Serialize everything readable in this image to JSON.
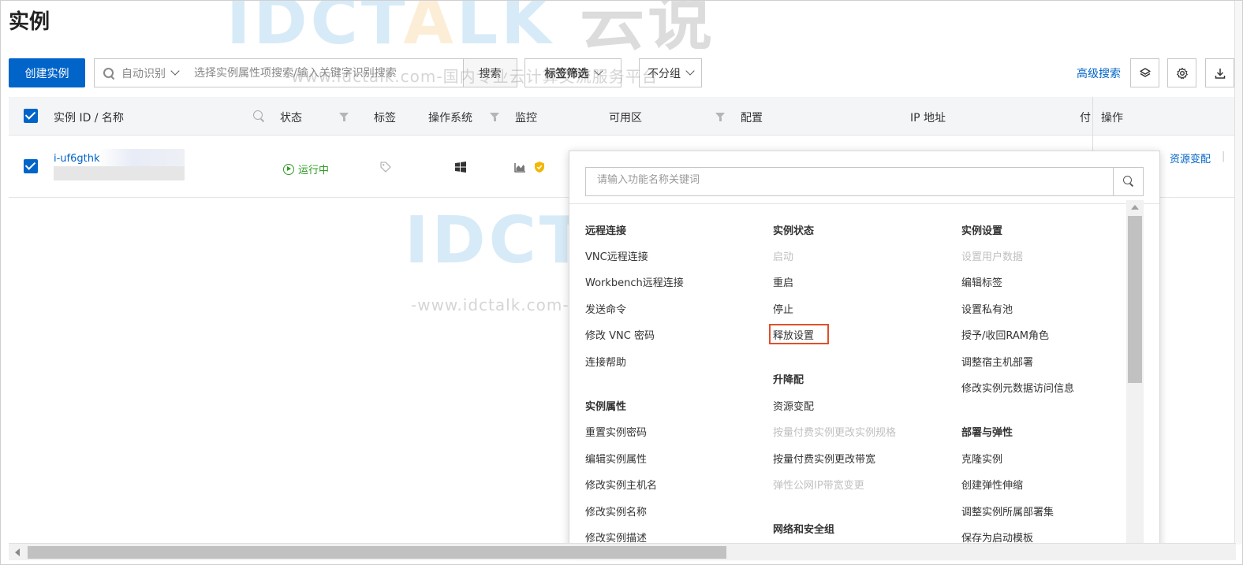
{
  "page": {
    "title": "实例"
  },
  "toolbar": {
    "create_label": "创建实例",
    "auto_identify": "自动识别",
    "search_placeholder": "选择实例属性项搜索/输入关键字识别搜索",
    "search_label": "搜索",
    "tag_filter": "标签筛选",
    "group": "不分组",
    "advanced_search": "高级搜索"
  },
  "table": {
    "headers": {
      "id_name": "实例 ID / 名称",
      "status": "状态",
      "tags": "标签",
      "os": "操作系统",
      "monitor": "监控",
      "zone": "可用区",
      "config": "配置",
      "ip": "IP 地址",
      "pay": "付",
      "ops": "操作"
    },
    "row": {
      "instance_id": "i-uf6gthk",
      "status": "运行中",
      "op_resource": "资源变配"
    }
  },
  "popup": {
    "search_placeholder": "请输入功能名称关键词",
    "col1": {
      "remote_title": "远程连接",
      "remote_items": [
        "VNC远程连接",
        "Workbench远程连接",
        "发送命令",
        "修改 VNC 密码",
        "连接帮助"
      ],
      "props_title": "实例属性",
      "props_items": [
        "重置实例密码",
        "编辑实例属性",
        "修改实例主机名",
        "修改实例名称",
        "修改实例描述"
      ]
    },
    "col2": {
      "state_title": "实例状态",
      "state_items": [
        "启动",
        "重启",
        "停止",
        "释放设置"
      ],
      "upgrade_title": "升降配",
      "upgrade_items": [
        "资源变配",
        "按量付费实例更改实例规格",
        "按量付费实例更改带宽",
        "弹性公网IP带宽变更"
      ],
      "network_title": "网络和安全组"
    },
    "col3": {
      "settings_title": "实例设置",
      "settings_items": [
        "设置用户数据",
        "编辑标签",
        "设置私有池",
        "授予/收回RAM角色",
        "调整宿主机部署",
        "修改实例元数据访问信息"
      ],
      "deploy_title": "部署与弹性",
      "deploy_items": [
        "克隆实例",
        "创建弹性伸缩",
        "调整实例所属部署集",
        "保存为启动模板"
      ]
    }
  },
  "watermark": {
    "logo_a": "IDC",
    "logo_b": "T",
    "logo_c": "A",
    "logo_d": "LK",
    "logo_e": "云说",
    "sub": "-www.idctalk.com-国内专业云计算交流服务平台-"
  },
  "colors": {
    "primary": "#0064c8",
    "running": "#2e9b23",
    "highlight": "#e0502a"
  }
}
